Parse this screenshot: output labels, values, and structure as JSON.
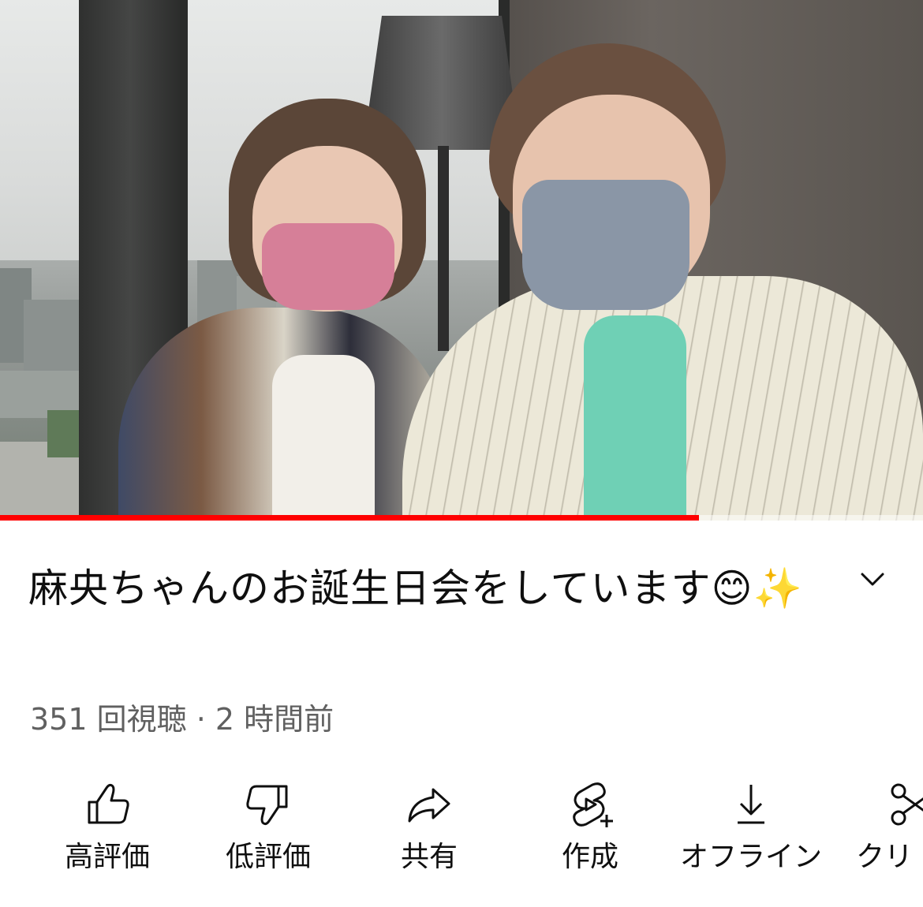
{
  "video": {
    "progress_fraction": 0.757
  },
  "title": "麻央ちゃんのお誕生日会をしています😊✨",
  "meta": {
    "views": "351 回視聴",
    "separator": "·",
    "time_ago": "2 時間前"
  },
  "actions": [
    {
      "icon": "thumbs-up-icon",
      "label": "高評価"
    },
    {
      "icon": "thumbs-down-icon",
      "label": "低評価"
    },
    {
      "icon": "share-icon",
      "label": "共有"
    },
    {
      "icon": "create-shorts-icon",
      "label": "作成"
    },
    {
      "icon": "download-icon",
      "label": "オフライン"
    },
    {
      "icon": "scissors-icon",
      "label": "クリ"
    }
  ],
  "colors": {
    "progress": "#ff0000",
    "text_primary": "#0f0f0f",
    "text_secondary": "#606060"
  }
}
